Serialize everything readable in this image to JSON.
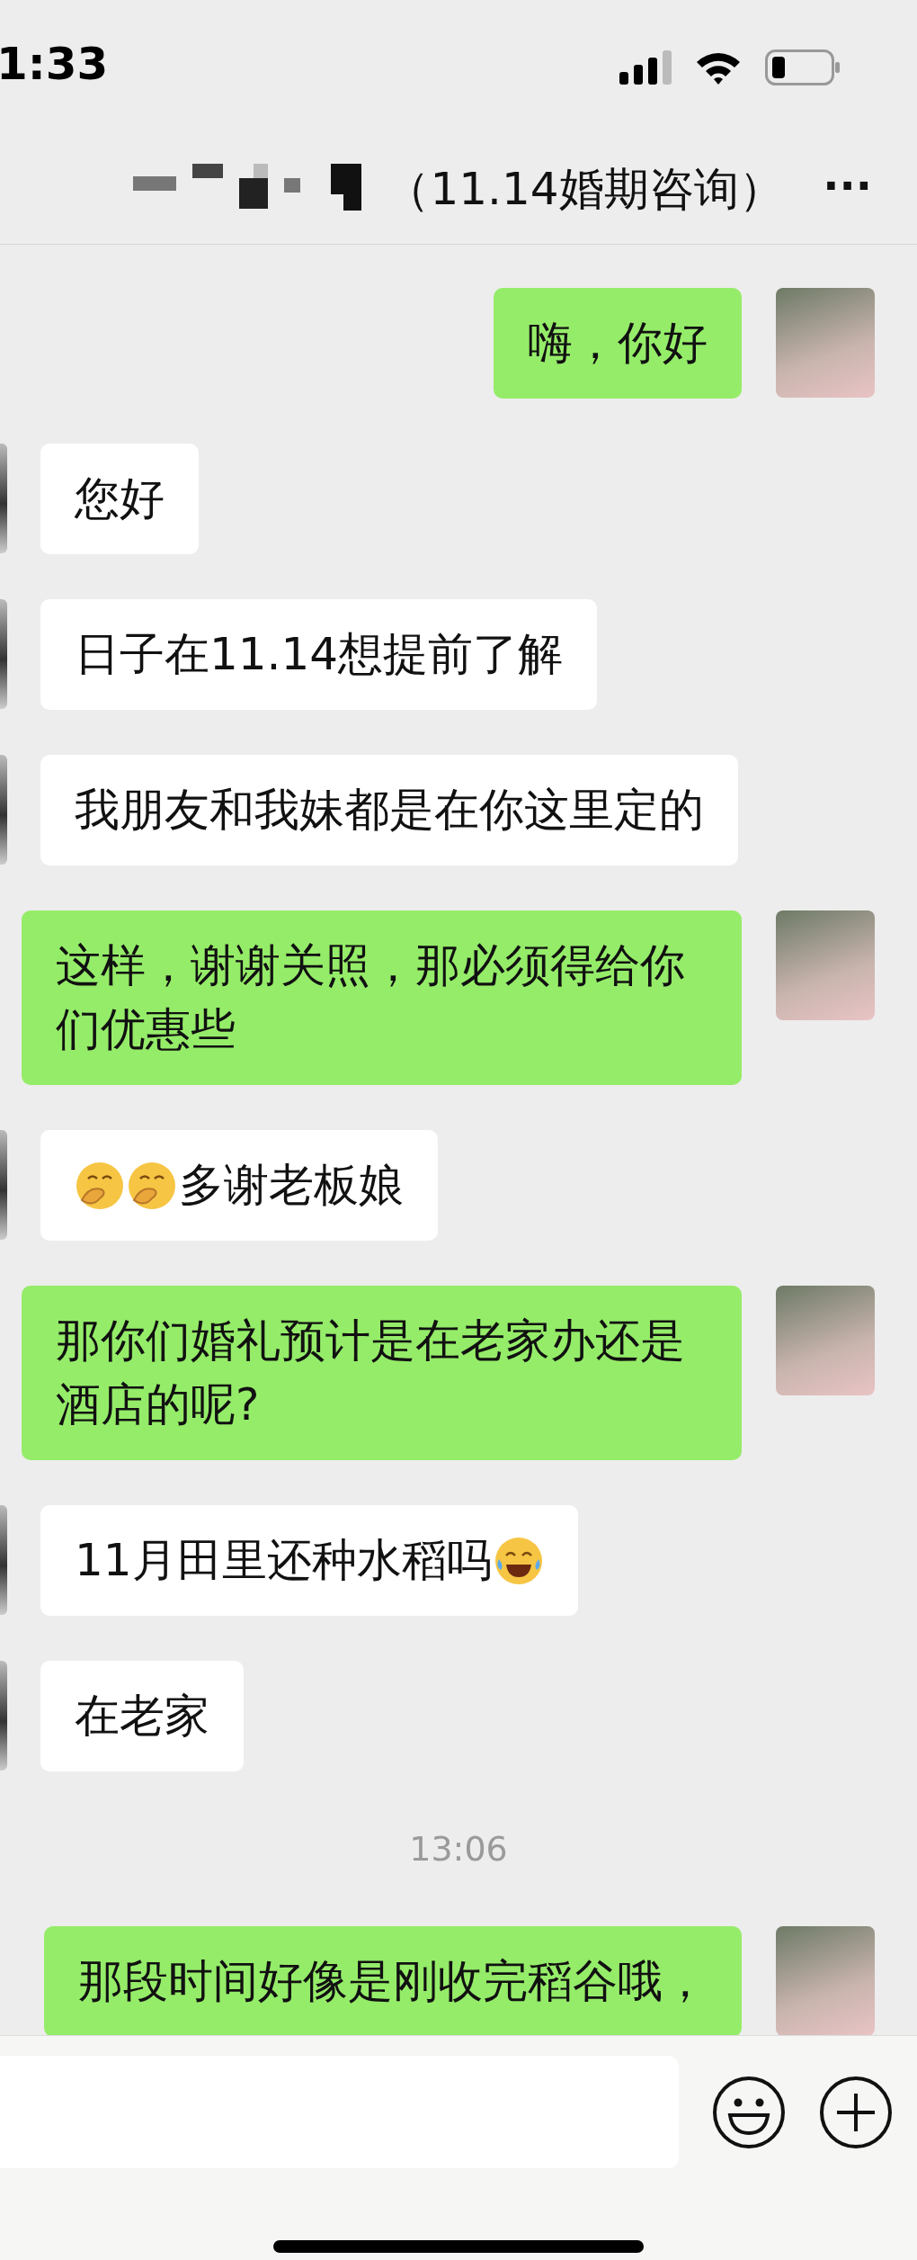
{
  "status_bar": {
    "time": "1:33"
  },
  "header": {
    "title": "（11.14婚期咨询）",
    "more": "···"
  },
  "messages": [
    {
      "kind": "outgoing",
      "segments": [
        {
          "kind": "text",
          "text": "嗨，你好"
        }
      ]
    },
    {
      "kind": "incoming",
      "segments": [
        {
          "kind": "text",
          "text": "您好"
        }
      ]
    },
    {
      "kind": "incoming",
      "segments": [
        {
          "kind": "text",
          "text": "日子在11.14想提前了解"
        }
      ]
    },
    {
      "kind": "incoming",
      "segments": [
        {
          "kind": "text",
          "text": "我朋友和我妹都是在你这里定的"
        }
      ]
    },
    {
      "kind": "outgoing",
      "segments": [
        {
          "kind": "text",
          "text": "这样，谢谢关照，那必须得给你们优惠些"
        }
      ]
    },
    {
      "kind": "incoming",
      "segments": [
        {
          "kind": "shy"
        },
        {
          "kind": "shy"
        },
        {
          "kind": "text",
          "text": "多谢老板娘"
        }
      ]
    },
    {
      "kind": "outgoing",
      "segments": [
        {
          "kind": "text",
          "text": "那你们婚礼预计是在老家办还是酒店的呢?"
        }
      ]
    },
    {
      "kind": "incoming",
      "segments": [
        {
          "kind": "text",
          "text": "11月田里还种水稻吗"
        },
        {
          "kind": "laugh"
        }
      ]
    },
    {
      "kind": "incoming",
      "segments": [
        {
          "kind": "text",
          "text": "在老家"
        }
      ]
    },
    {
      "kind": "timestamp",
      "segments": [
        {
          "kind": "text",
          "text": "13:06"
        }
      ]
    },
    {
      "kind": "outgoing",
      "segments": [
        {
          "kind": "text",
          "text": "那段时间好像是刚收完稻谷哦，"
        }
      ]
    }
  ]
}
